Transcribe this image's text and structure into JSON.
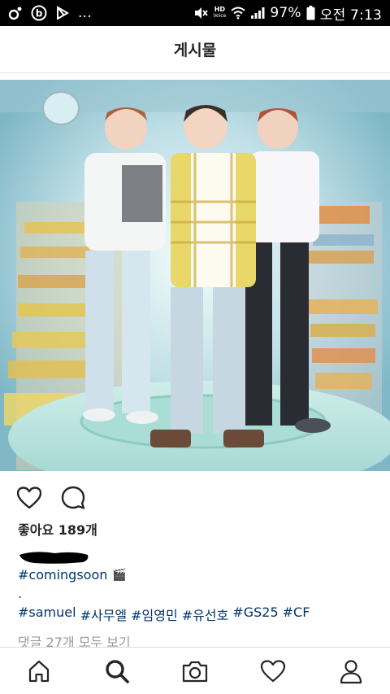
{
  "status_bar": {
    "left_icons": [
      "app-notification-icon",
      "b-app-icon",
      "play-store-icon"
    ],
    "overflow": "...",
    "hd_label": "HD",
    "voice_label": "Voice",
    "battery_percent": "97%",
    "time": "오전 7:13"
  },
  "header": {
    "title": "게시물"
  },
  "post": {
    "likes": "좋아요 189개",
    "caption_hashtag": "#comingsoon",
    "caption_emoji": "🎬",
    "dot_line": ".",
    "tags": [
      "#samuel",
      "#사무엘",
      "#임영민",
      "#유선호",
      "#GS25",
      "#CF"
    ],
    "comments_link": "댓글 27개 모두 보기"
  },
  "colors": {
    "text": "#262626",
    "hashtag": "#003569",
    "muted": "#999999",
    "divider": "#dbdbdb"
  },
  "bottom_nav": [
    "home-icon",
    "search-icon",
    "camera-icon",
    "activity-heart-icon",
    "profile-icon"
  ]
}
